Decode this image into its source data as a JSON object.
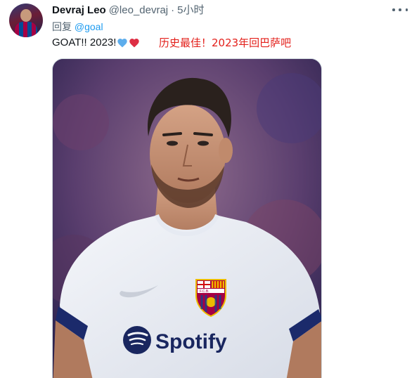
{
  "tweet": {
    "author": {
      "display_name": "Devraj Leo",
      "handle": "@leo_devraj",
      "separator": "·",
      "time": "5小时"
    },
    "reply": {
      "prefix": "回复",
      "mention": "@goal"
    },
    "text": "GOAT!! 2023!",
    "emojis": [
      "blue-heart-icon",
      "red-heart-icon"
    ],
    "annotation": "历史最佳！2023年回巴萨吧",
    "media": {
      "shirt_sponsor": "Spotify",
      "crest_text": "F.C.B.",
      "kit_brand": "nike-swoosh-icon"
    }
  },
  "colors": {
    "text_primary": "#0f1419",
    "text_secondary": "#536471",
    "link": "#1d9bf0",
    "annotation": "#e3201b",
    "heart_blue": "#5dadec",
    "heart_red": "#dd2e44"
  }
}
